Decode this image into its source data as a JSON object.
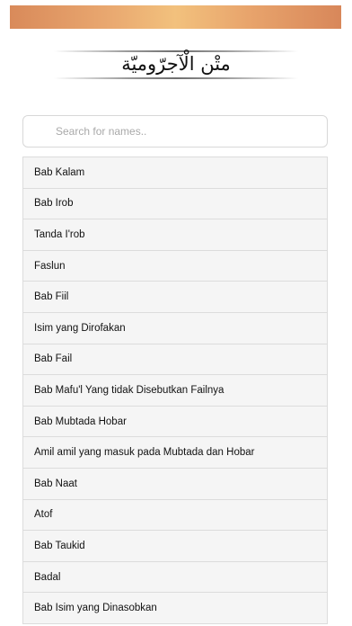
{
  "header": {
    "title": "متْن الْآجرّوميّة"
  },
  "search": {
    "placeholder": "Search for names.."
  },
  "list": {
    "items": [
      "Bab Kalam",
      "Bab Irob",
      "Tanda I'rob",
      "Faslun",
      "Bab Fiil",
      "Isim yang Dirofakan",
      "Bab Fail",
      "Bab Mafu'l Yang tidak Disebutkan Failnya",
      "Bab Mubtada Hobar",
      "Amil amil yang masuk pada Mubtada dan Hobar",
      "Bab Naat",
      "Atof",
      "Bab Taukid",
      "Badal",
      "Bab Isim yang Dinasobkan"
    ]
  }
}
